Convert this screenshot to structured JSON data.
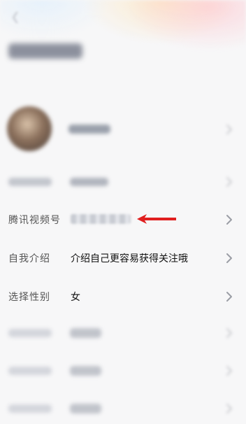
{
  "profile": {
    "rows": [
      {
        "label": "腾讯视频号"
      },
      {
        "label": "自我介绍",
        "value": "介绍自己更容易获得关注哦"
      },
      {
        "label": "选择性别",
        "value": "女"
      }
    ]
  },
  "colors": {
    "accent_arrow": "#e01f1f",
    "chevron": "#9b9ea5"
  },
  "icons": {
    "back": "back-arrow-icon",
    "chevron": "chevron-right-icon",
    "annotation": "red-arrow-icon"
  }
}
